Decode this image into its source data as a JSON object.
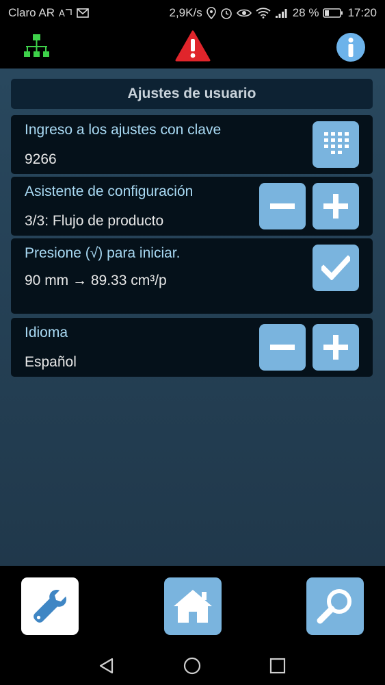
{
  "status_bar": {
    "carrier": "Claro AR",
    "network_speed": "2,9K/s",
    "battery": "28 %",
    "time": "17:20"
  },
  "header": {
    "section_title": "Ajustes de usuario"
  },
  "settings": [
    {
      "title": "Ingreso a los ajustes con clave",
      "value": "9266"
    },
    {
      "title": "Asistente de configuración",
      "value": "3/3: Flujo de producto"
    },
    {
      "title": "Presione (√) para iniciar.",
      "value": "90 mm → 89.33 cm³/p"
    },
    {
      "title": "Idioma",
      "value": "Español"
    }
  ],
  "icons": {
    "top_left": "network-tree-icon",
    "top_center": "warning-icon",
    "top_right": "info-icon",
    "bottom_left": "wrench-icon",
    "bottom_center": "home-icon",
    "bottom_right": "search-icon"
  },
  "colors": {
    "accent_button": "#7ab4de",
    "title_text": "#a9daf4",
    "warning": "#e0252b",
    "network": "#3ed14a"
  }
}
